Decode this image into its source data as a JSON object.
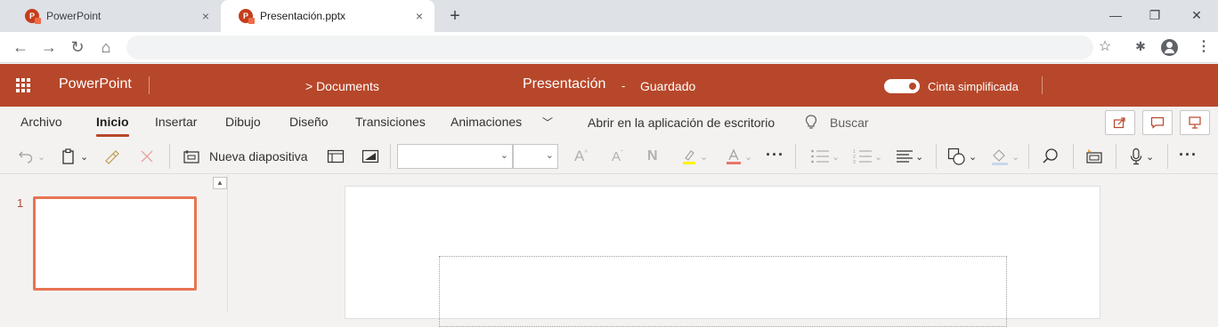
{
  "browser": {
    "tabs": [
      {
        "title": "PowerPoint",
        "active": false
      },
      {
        "title": "Presentación.pptx",
        "active": true
      }
    ],
    "favicon_letter": "P",
    "url": ""
  },
  "app": {
    "name": "PowerPoint",
    "breadcrumb": "> Documents",
    "doc_title": "Presentación",
    "separator": "-",
    "save_status": "Guardado",
    "simplified_ribbon_label": "Cinta simplificada",
    "simplified_ribbon_on": true,
    "accent_color": "#b7472a"
  },
  "menu": {
    "tabs": [
      "Archivo",
      "Inicio",
      "Insertar",
      "Dibujo",
      "Diseño",
      "Transiciones",
      "Animaciones"
    ],
    "active_tab": "Inicio",
    "open_in_desktop": "Abrir en la aplicación de escritorio",
    "search_label": "Buscar"
  },
  "toolbar": {
    "new_slide_label": "Nueva diapositiva",
    "font_name": "",
    "font_size": ""
  },
  "slides": {
    "thumbnails": [
      {
        "number": "1"
      }
    ]
  }
}
